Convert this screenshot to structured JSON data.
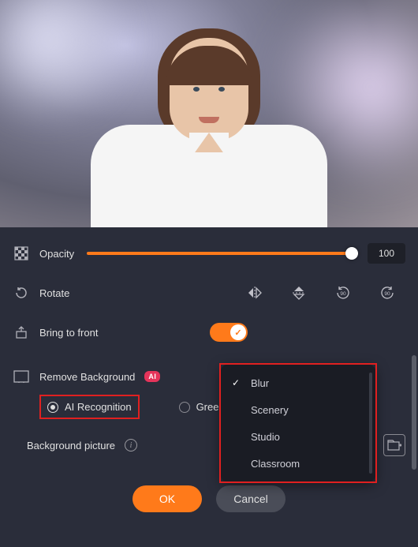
{
  "opacity": {
    "label": "Opacity",
    "value": "100",
    "percent": 100
  },
  "rotate": {
    "label": "Rotate"
  },
  "bring_front": {
    "label": "Bring to front",
    "enabled": true
  },
  "remove_bg": {
    "label": "Remove Background",
    "badge": "AI",
    "options": {
      "ai": "AI Recognition",
      "green": "Green"
    },
    "selected": "ai"
  },
  "dropdown": {
    "items": [
      "Blur",
      "Scenery",
      "Studio",
      "Classroom"
    ],
    "selected": "Blur"
  },
  "bg_picture": {
    "label": "Background picture",
    "value": "Blur"
  },
  "buttons": {
    "ok": "OK",
    "cancel": "Cancel"
  }
}
